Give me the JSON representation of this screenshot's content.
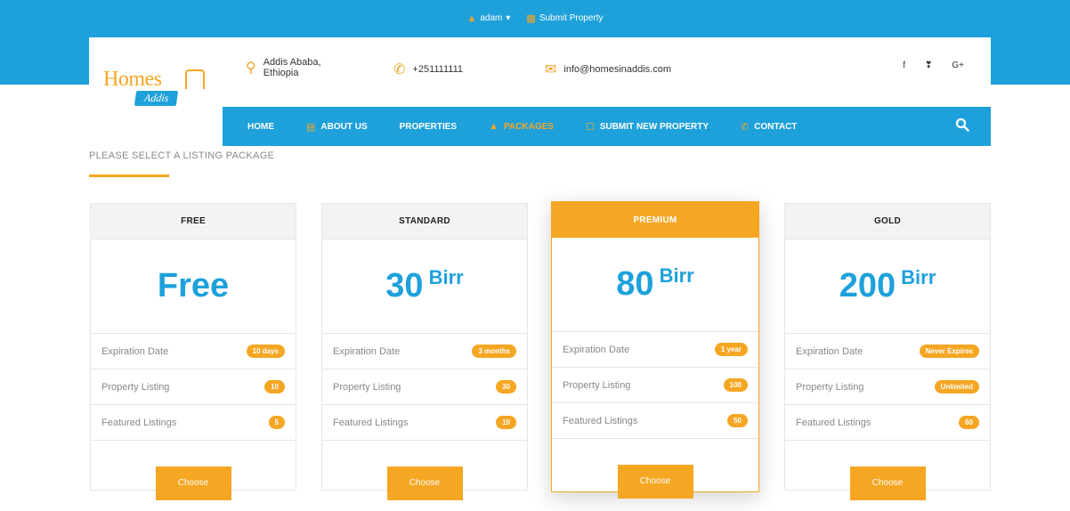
{
  "topbar": {
    "user_label": "adam",
    "submit_label": "Submit Property"
  },
  "brand": {
    "logo_main": "Homes",
    "logo_sub": "Addis"
  },
  "header": {
    "address_line1": "Addis Ababa,",
    "address_line2": "Ethiopia",
    "phone": "+251111111",
    "email": "info@homesinaddis.com",
    "social": [
      "f",
      "❣",
      "G+"
    ]
  },
  "nav": {
    "items": [
      {
        "label": "HOME"
      },
      {
        "label": "ABOUT US"
      },
      {
        "label": "PROPERTIES"
      },
      {
        "label": "PACKAGES"
      },
      {
        "label": "SUBMIT NEW PROPERTY"
      },
      {
        "label": "CONTACT"
      }
    ]
  },
  "page": {
    "title": "PLEASE SELECT A LISTING PACKAGE"
  },
  "packages": [
    {
      "name": "FREE",
      "price": "Free",
      "unit": "",
      "expiration_label": "Expiration Date",
      "expiration": "10 days",
      "listing_label": "Property Listing",
      "listing": "10",
      "featured_label": "Featured Listings",
      "featured": "5",
      "button": "Choose"
    },
    {
      "name": "STANDARD",
      "price": "30",
      "unit": "Birr",
      "expiration_label": "Expiration Date",
      "expiration": "3 months",
      "listing_label": "Property Listing",
      "listing": "30",
      "featured_label": "Featured Listings",
      "featured": "10",
      "button": "Choose"
    },
    {
      "name": "PREMIUM",
      "price": "80",
      "unit": "Birr",
      "expiration_label": "Expiration Date",
      "expiration": "1 year",
      "listing_label": "Property Listing",
      "listing": "100",
      "featured_label": "Featured Listings",
      "featured": "50",
      "button": "Choose"
    },
    {
      "name": "GOLD",
      "price": "200",
      "unit": "Birr",
      "expiration_label": "Expiration Date",
      "expiration": "Never Expires",
      "listing_label": "Property Listing",
      "listing": "Unlimited",
      "featured_label": "Featured Listings",
      "featured": "60",
      "button": "Choose"
    }
  ],
  "colors": {
    "brand_blue": "#1ea1db",
    "accent_orange": "#f5a623"
  }
}
